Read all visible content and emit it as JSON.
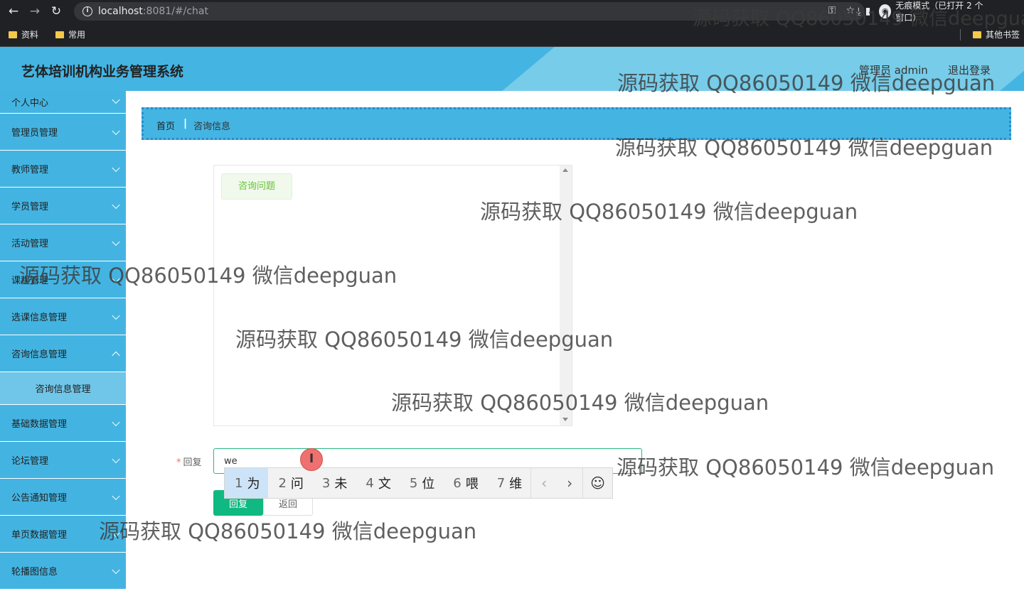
{
  "browser": {
    "url_host": "localhost",
    "url_path": ":8081/#/chat",
    "incognito_label": "无痕模式（已打开 2 个窗口）",
    "bookmarks": [
      "资料",
      "常用"
    ],
    "other_bookmarks": "其他书签"
  },
  "app": {
    "title": "艺体培训机构业务管理系统",
    "user_label": "管理员 admin",
    "logout_label": "退出登录"
  },
  "sidebar": {
    "items": [
      {
        "label": "个人中心"
      },
      {
        "label": "管理员管理"
      },
      {
        "label": "教师管理"
      },
      {
        "label": "学员管理"
      },
      {
        "label": "活动管理"
      },
      {
        "label": "课程管理"
      },
      {
        "label": "选课信息管理"
      },
      {
        "label": "咨询信息管理"
      },
      {
        "label": "咨询信息管理"
      },
      {
        "label": "基础数据管理"
      },
      {
        "label": "论坛管理"
      },
      {
        "label": "公告通知管理"
      },
      {
        "label": "单页数据管理"
      },
      {
        "label": "轮播图信息"
      }
    ]
  },
  "breadcrumb": {
    "home": "首页",
    "separator": "|",
    "current": "咨询信息"
  },
  "chat": {
    "messages": [
      {
        "text": "咨询问题"
      }
    ]
  },
  "form": {
    "reply_required_mark": "*",
    "reply_label": "回复",
    "reply_value": "we",
    "reply_button": "回复",
    "back_button": "返回"
  },
  "ime": {
    "candidates": [
      {
        "num": "1",
        "char": "为"
      },
      {
        "num": "2",
        "char": "问"
      },
      {
        "num": "3",
        "char": "未"
      },
      {
        "num": "4",
        "char": "文"
      },
      {
        "num": "5",
        "char": "位"
      },
      {
        "num": "6",
        "char": "喂"
      },
      {
        "num": "7",
        "char": "维"
      }
    ],
    "prev": "‹",
    "next": "›",
    "emoji": "☺"
  },
  "watermark": "源码获取 QQ86050149 微信deepguan",
  "colors": {
    "header_bg": "#44b5e3",
    "menu_bg": "#43b4e2",
    "submenu_bg": "#6fc6e9",
    "primary_button": "#10b981",
    "chat_bubble_text": "#67c23a"
  }
}
